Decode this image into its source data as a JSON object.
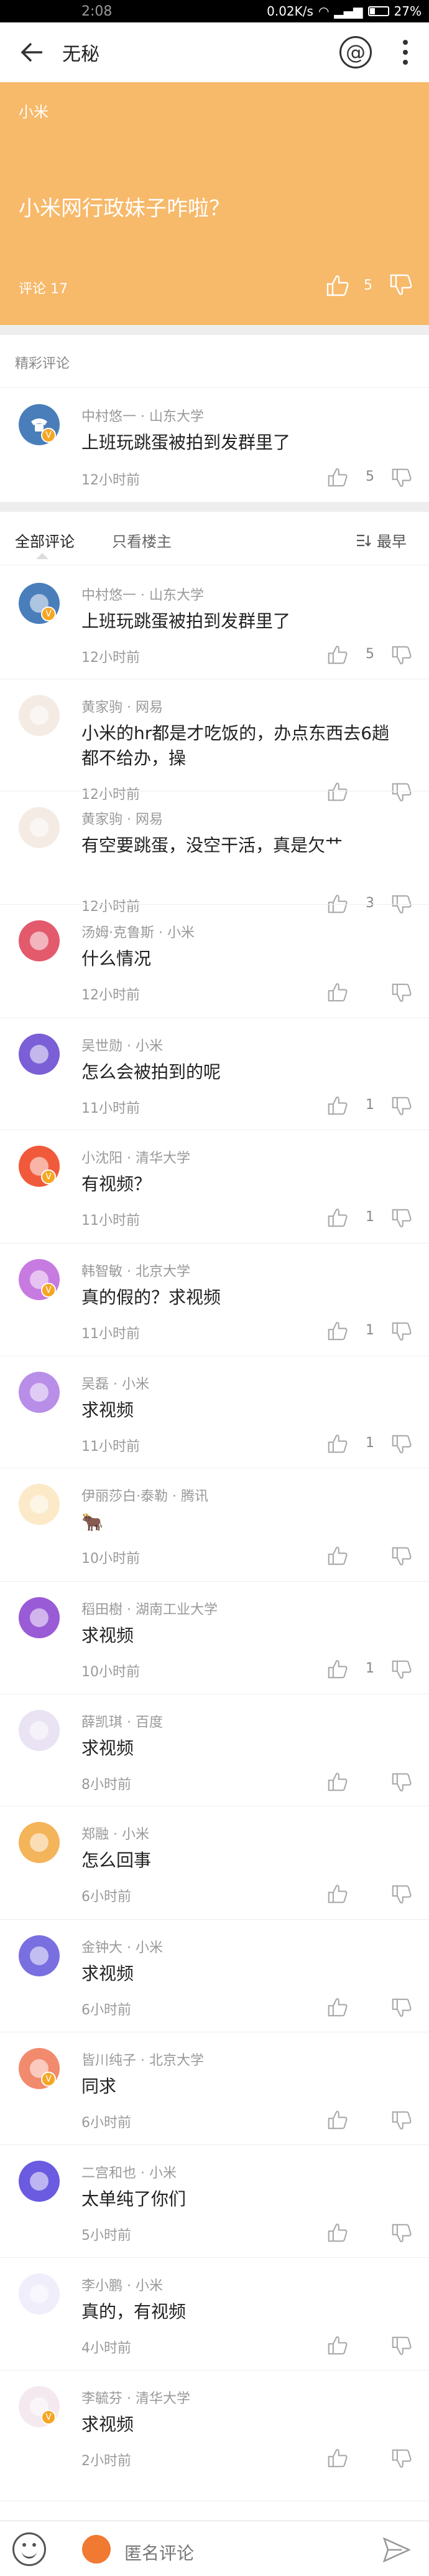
{
  "status_bar": {
    "time": "2:08",
    "right_text": "0.02K/s",
    "battery": "27%"
  },
  "topbar": {
    "title": "无秘"
  },
  "post": {
    "tag": "小米",
    "question": "小米网行政妹子咋啦？",
    "comment_count": "评论 17",
    "like_count": "5"
  },
  "featured": {
    "label": "精彩评论"
  },
  "tabs": {
    "all": "全部评论",
    "op_only": "只看楼主",
    "sort": "最早"
  },
  "featured_comment": {
    "author": "中村悠一 · 山东大学",
    "text": "上班玩跳蛋被拍到发群里了",
    "time": "12小时前",
    "likes": "5",
    "avatar_color": "#4a7ebb",
    "avatar_icon": "phone-icon",
    "badge": true
  },
  "comments": [
    {
      "author": "中村悠一 · 山东大学",
      "text": "上班玩跳蛋被拍到发群里了",
      "time": "12小时前",
      "likes": "5",
      "avatar_color": "#4a7ebb",
      "avatar_icon": "phone-icon",
      "badge": true
    },
    {
      "author": "黄家驹 · 网易",
      "text": "小米的hr都是才吃饭的，办点东西去6趟都不给办，操",
      "time": "12小时前",
      "likes": "",
      "avatar_color": "#f4ece4",
      "avatar_icon": "deer-icon",
      "badge": false
    },
    {
      "author": "黄家驹 · 网易",
      "text": "有空要跳蛋，没空干活，真是欠艹",
      "time": "12小时前",
      "likes": "3",
      "avatar_color": "#f4ece4",
      "avatar_icon": "deer-icon",
      "badge": false
    },
    {
      "author": "汤姆·克鲁斯 · 小米",
      "text": "什么情况",
      "time": "12小时前",
      "likes": "",
      "avatar_color": "#e35a6d",
      "avatar_icon": "mask-icon",
      "badge": false
    },
    {
      "author": "吴世勋 · 小米",
      "text": "怎么会被拍到的呢",
      "time": "11小时前",
      "likes": "1",
      "avatar_color": "#7a5fd6",
      "avatar_icon": "skull-icon",
      "badge": false
    },
    {
      "author": "小沈阳 · 清华大学",
      "text": "有视频？",
      "time": "11小时前",
      "likes": "1",
      "avatar_color": "#f05a3a",
      "avatar_icon": "burger-icon",
      "badge": true
    },
    {
      "author": "韩智敏 · 北京大学",
      "text": "真的假的？求视频",
      "time": "11小时前",
      "likes": "1",
      "avatar_color": "#c77be0",
      "avatar_icon": "comb-icon",
      "badge": true
    },
    {
      "author": "吴磊 · 小米",
      "text": "求视频",
      "time": "11小时前",
      "likes": "1",
      "avatar_color": "#b88ee8",
      "avatar_icon": "pen-icon",
      "badge": false
    },
    {
      "author": "伊丽莎白·泰勒 · 腾讯",
      "text": "🐂",
      "time": "10小时前",
      "likes": "",
      "avatar_color": "#fbe9c8",
      "avatar_icon": "noodle-icon",
      "badge": false
    },
    {
      "author": "稻田樹 · 湖南工业大学",
      "text": "求视频",
      "time": "10小时前",
      "likes": "1",
      "avatar_color": "#9a5bd6",
      "avatar_icon": "flower-icon",
      "badge": false
    },
    {
      "author": "薛凯琪 · 百度",
      "text": "求视频",
      "time": "8小时前",
      "likes": "",
      "avatar_color": "#e9e3f4",
      "avatar_icon": "card-icon",
      "badge": false
    },
    {
      "author": "郑融 · 小米",
      "text": "怎么回事",
      "time": "6小时前",
      "likes": "",
      "avatar_color": "#f4b45a",
      "avatar_icon": "bear-icon",
      "badge": false
    },
    {
      "author": "金钟大 · 小米",
      "text": "求视频",
      "time": "6小时前",
      "likes": "",
      "avatar_color": "#7a6fe0",
      "avatar_icon": "brush-icon",
      "badge": false
    },
    {
      "author": "皆川纯子 · 北京大学",
      "text": "同求",
      "time": "6小时前",
      "likes": "",
      "avatar_color": "#f28a6d",
      "avatar_icon": "shrimp-icon",
      "badge": true
    },
    {
      "author": "二宫和也 · 小米",
      "text": "太单纯了你们",
      "time": "5小时前",
      "likes": "",
      "avatar_color": "#6a5be0",
      "avatar_icon": "ball-icon",
      "badge": false
    },
    {
      "author": "李小鹏 · 小米",
      "text": "真的，有视频",
      "time": "4小时前",
      "likes": "",
      "avatar_color": "#f0eefb",
      "avatar_icon": "popsicle-icon",
      "badge": false
    },
    {
      "author": "李毓芬 · 清华大学",
      "text": "求视频",
      "time": "2小时前",
      "likes": "",
      "avatar_color": "#f3e9ef",
      "avatar_icon": "candle-icon",
      "badge": true
    }
  ],
  "composer": {
    "placeholder": "匿名评论"
  }
}
